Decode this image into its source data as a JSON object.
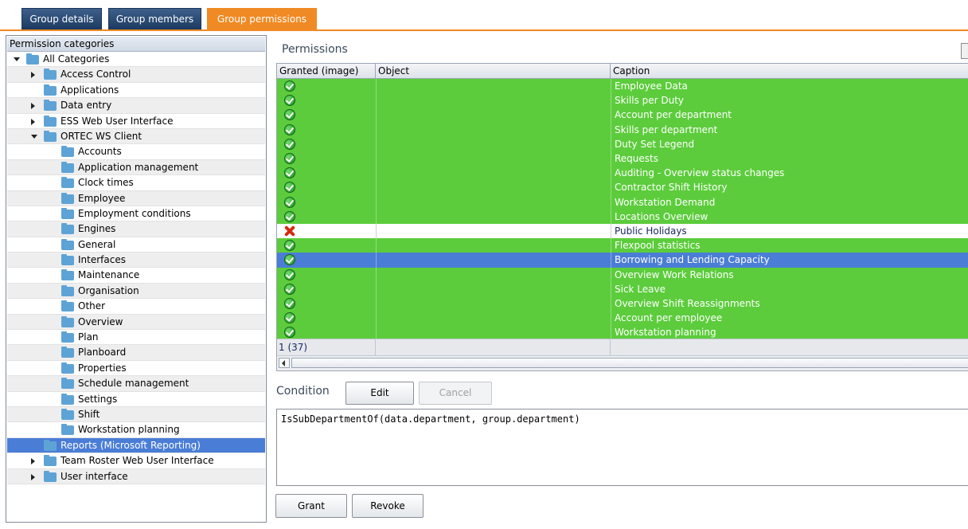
{
  "tabs": [
    {
      "label": "Group details",
      "active": false
    },
    {
      "label": "Group members",
      "active": false
    },
    {
      "label": "Group permissions",
      "active": true
    }
  ],
  "left_panel": {
    "header": "Permission categories",
    "items": [
      {
        "label": "All Categories",
        "depth": 0,
        "expander": "down"
      },
      {
        "label": "Access Control",
        "depth": 1,
        "expander": "right"
      },
      {
        "label": "Applications",
        "depth": 1,
        "expander": "none"
      },
      {
        "label": "Data entry",
        "depth": 1,
        "expander": "right"
      },
      {
        "label": "ESS Web User Interface",
        "depth": 1,
        "expander": "right"
      },
      {
        "label": "ORTEC WS Client",
        "depth": 1,
        "expander": "down"
      },
      {
        "label": "Accounts",
        "depth": 2,
        "expander": "none"
      },
      {
        "label": "Application management",
        "depth": 2,
        "expander": "none"
      },
      {
        "label": "Clock times",
        "depth": 2,
        "expander": "none"
      },
      {
        "label": "Employee",
        "depth": 2,
        "expander": "none"
      },
      {
        "label": "Employment conditions",
        "depth": 2,
        "expander": "none"
      },
      {
        "label": "Engines",
        "depth": 2,
        "expander": "none"
      },
      {
        "label": "General",
        "depth": 2,
        "expander": "none"
      },
      {
        "label": "Interfaces",
        "depth": 2,
        "expander": "none"
      },
      {
        "label": "Maintenance",
        "depth": 2,
        "expander": "none"
      },
      {
        "label": "Organisation",
        "depth": 2,
        "expander": "none"
      },
      {
        "label": "Other",
        "depth": 2,
        "expander": "none"
      },
      {
        "label": "Overview",
        "depth": 2,
        "expander": "none"
      },
      {
        "label": "Plan",
        "depth": 2,
        "expander": "none"
      },
      {
        "label": "Planboard",
        "depth": 2,
        "expander": "none"
      },
      {
        "label": "Properties",
        "depth": 2,
        "expander": "none"
      },
      {
        "label": "Schedule management",
        "depth": 2,
        "expander": "none"
      },
      {
        "label": "Settings",
        "depth": 2,
        "expander": "none"
      },
      {
        "label": "Shift",
        "depth": 2,
        "expander": "none"
      },
      {
        "label": "Workstation planning",
        "depth": 2,
        "expander": "none"
      },
      {
        "label": "Reports (Microsoft Reporting)",
        "depth": 1,
        "expander": "none",
        "selected": true
      },
      {
        "label": "Team Roster Web User Interface",
        "depth": 1,
        "expander": "right"
      },
      {
        "label": "User interface",
        "depth": 1,
        "expander": "right"
      }
    ]
  },
  "permissions": {
    "title": "Permissions",
    "columns": [
      "Granted (image)",
      "Object",
      "Caption"
    ],
    "rows": [
      {
        "granted": true,
        "object": "",
        "caption": "Employee Data"
      },
      {
        "granted": true,
        "object": "",
        "caption": "Skills per Duty"
      },
      {
        "granted": true,
        "object": "",
        "caption": "Account per department"
      },
      {
        "granted": true,
        "object": "",
        "caption": "Skills per department"
      },
      {
        "granted": true,
        "object": "",
        "caption": "Duty Set Legend"
      },
      {
        "granted": true,
        "object": "",
        "caption": "Requests"
      },
      {
        "granted": true,
        "object": "",
        "caption": "Auditing - Overview status changes"
      },
      {
        "granted": true,
        "object": "",
        "caption": "Contractor Shift History"
      },
      {
        "granted": true,
        "object": "",
        "caption": "Workstation Demand"
      },
      {
        "granted": true,
        "object": "",
        "caption": "Locations Overview"
      },
      {
        "granted": false,
        "object": "",
        "caption": "Public Holidays"
      },
      {
        "granted": true,
        "object": "",
        "caption": "Flexpool statistics"
      },
      {
        "granted": true,
        "object": "",
        "caption": "Borrowing and Lending Capacity",
        "selected": true
      },
      {
        "granted": true,
        "object": "",
        "caption": "Overview Work Relations"
      },
      {
        "granted": true,
        "object": "",
        "caption": "Sick Leave"
      },
      {
        "granted": true,
        "object": "",
        "caption": "Overview Shift Reassignments"
      },
      {
        "granted": true,
        "object": "",
        "caption": "Account per employee"
      },
      {
        "granted": true,
        "object": "",
        "caption": "Workstation planning"
      }
    ],
    "footer_count": "1 (37)"
  },
  "condition": {
    "label": "Condition",
    "edit_label": "Edit",
    "cancel_label": "Cancel",
    "text": "IsSubDepartmentOf(data.department, group.department)"
  },
  "actions": {
    "grant_label": "Grant",
    "revoke_label": "Revoke"
  },
  "colors": {
    "accent": "#f08a24",
    "granted_row": "#5ccc3c",
    "selected_row": "#4a7dd6"
  }
}
